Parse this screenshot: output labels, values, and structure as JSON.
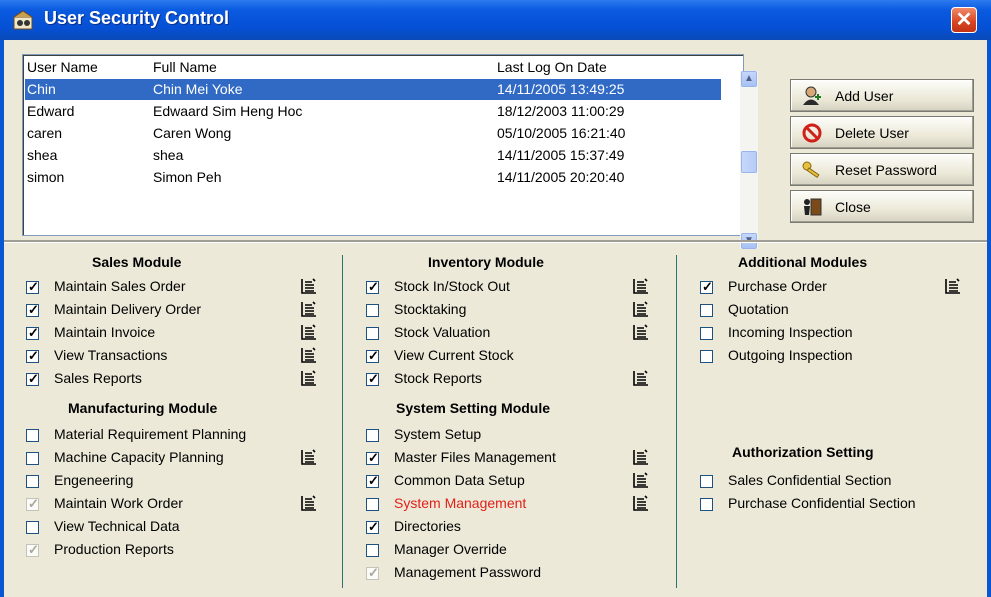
{
  "window": {
    "title": "User Security Control",
    "close_symbol": "✕"
  },
  "users": {
    "headers": [
      "User Name",
      "Full Name",
      "Last Log On Date"
    ],
    "rows": [
      [
        "Chin",
        "Chin Mei Yoke",
        "14/11/2005 13:49:25"
      ],
      [
        "Edward",
        "Edwaard Sim Heng Hoc",
        "18/12/2003 11:00:29"
      ],
      [
        "caren",
        "Caren Wong",
        "05/10/2005 16:21:40"
      ],
      [
        "shea",
        "shea",
        "14/11/2005 15:37:49"
      ],
      [
        "simon",
        "Simon Peh",
        "14/11/2005 20:20:40"
      ]
    ],
    "selected_index": 0
  },
  "buttons": [
    {
      "label": "Add User",
      "icon": "user-add-icon"
    },
    {
      "label": "Delete User",
      "icon": "no-entry-icon"
    },
    {
      "label": "Reset Password",
      "icon": "keys-icon"
    },
    {
      "label": "Close",
      "icon": "exit-door-icon"
    }
  ],
  "modules": {
    "sales": {
      "title": "Sales Module",
      "items": [
        {
          "label": "Maintain Sales Order",
          "checked": true,
          "enabled": true,
          "has_detail": true
        },
        {
          "label": "Maintain Delivery Order",
          "checked": true,
          "enabled": true,
          "has_detail": true
        },
        {
          "label": "Maintain Invoice",
          "checked": true,
          "enabled": true,
          "has_detail": true
        },
        {
          "label": "View Transactions",
          "checked": true,
          "enabled": true,
          "has_detail": true
        },
        {
          "label": "Sales Reports",
          "checked": true,
          "enabled": true,
          "has_detail": true
        }
      ]
    },
    "manufacturing": {
      "title": "Manufacturing Module",
      "items": [
        {
          "label": "Material Requirement Planning",
          "checked": false,
          "enabled": true,
          "has_detail": false
        },
        {
          "label": "Machine Capacity Planning",
          "checked": false,
          "enabled": true,
          "has_detail": true
        },
        {
          "label": "Engeneering",
          "checked": false,
          "enabled": true,
          "has_detail": false
        },
        {
          "label": "Maintain Work Order",
          "checked": true,
          "enabled": false,
          "has_detail": true
        },
        {
          "label": "View Technical Data",
          "checked": false,
          "enabled": true,
          "has_detail": false
        },
        {
          "label": "Production Reports",
          "checked": true,
          "enabled": false,
          "has_detail": false
        }
      ]
    },
    "inventory": {
      "title": "Inventory Module",
      "items": [
        {
          "label": "Stock In/Stock Out",
          "checked": true,
          "enabled": true,
          "has_detail": true
        },
        {
          "label": "Stocktaking",
          "checked": false,
          "enabled": true,
          "has_detail": true
        },
        {
          "label": "Stock Valuation",
          "checked": false,
          "enabled": true,
          "has_detail": true
        },
        {
          "label": "View Current Stock",
          "checked": true,
          "enabled": true,
          "has_detail": false
        },
        {
          "label": "Stock Reports",
          "checked": true,
          "enabled": true,
          "has_detail": true
        }
      ]
    },
    "system": {
      "title": "System Setting Module",
      "items": [
        {
          "label": "System Setup",
          "checked": false,
          "enabled": true,
          "has_detail": false
        },
        {
          "label": "Master Files Management",
          "checked": true,
          "enabled": true,
          "has_detail": true
        },
        {
          "label": "Common Data Setup",
          "checked": true,
          "enabled": true,
          "has_detail": true
        },
        {
          "label": "System Management",
          "checked": false,
          "enabled": true,
          "has_detail": true,
          "red": true
        },
        {
          "label": "Directories",
          "checked": true,
          "enabled": true,
          "has_detail": false
        },
        {
          "label": "Manager Override",
          "checked": false,
          "enabled": true,
          "has_detail": false
        },
        {
          "label": "Management Password",
          "checked": true,
          "enabled": false,
          "has_detail": false
        }
      ]
    },
    "additional": {
      "title": "Additional Modules",
      "items": [
        {
          "label": "Purchase Order",
          "checked": true,
          "enabled": true,
          "has_detail": true
        },
        {
          "label": "Quotation",
          "checked": false,
          "enabled": true,
          "has_detail": false
        },
        {
          "label": "Incoming Inspection",
          "checked": false,
          "enabled": true,
          "has_detail": false
        },
        {
          "label": "Outgoing Inspection",
          "checked": false,
          "enabled": true,
          "has_detail": false
        }
      ]
    },
    "authorization": {
      "title": "Authorization Setting",
      "items": [
        {
          "label": "Sales Confidential Section",
          "checked": false,
          "enabled": true,
          "has_detail": false
        },
        {
          "label": "Purchase Confidential Section",
          "checked": false,
          "enabled": true,
          "has_detail": false
        }
      ]
    }
  },
  "colors": {
    "titlebar": "#0550d4",
    "face": "#ece9d8",
    "selection": "#316ac5",
    "warning_text": "#e1201a",
    "divider": "#2e7272"
  }
}
